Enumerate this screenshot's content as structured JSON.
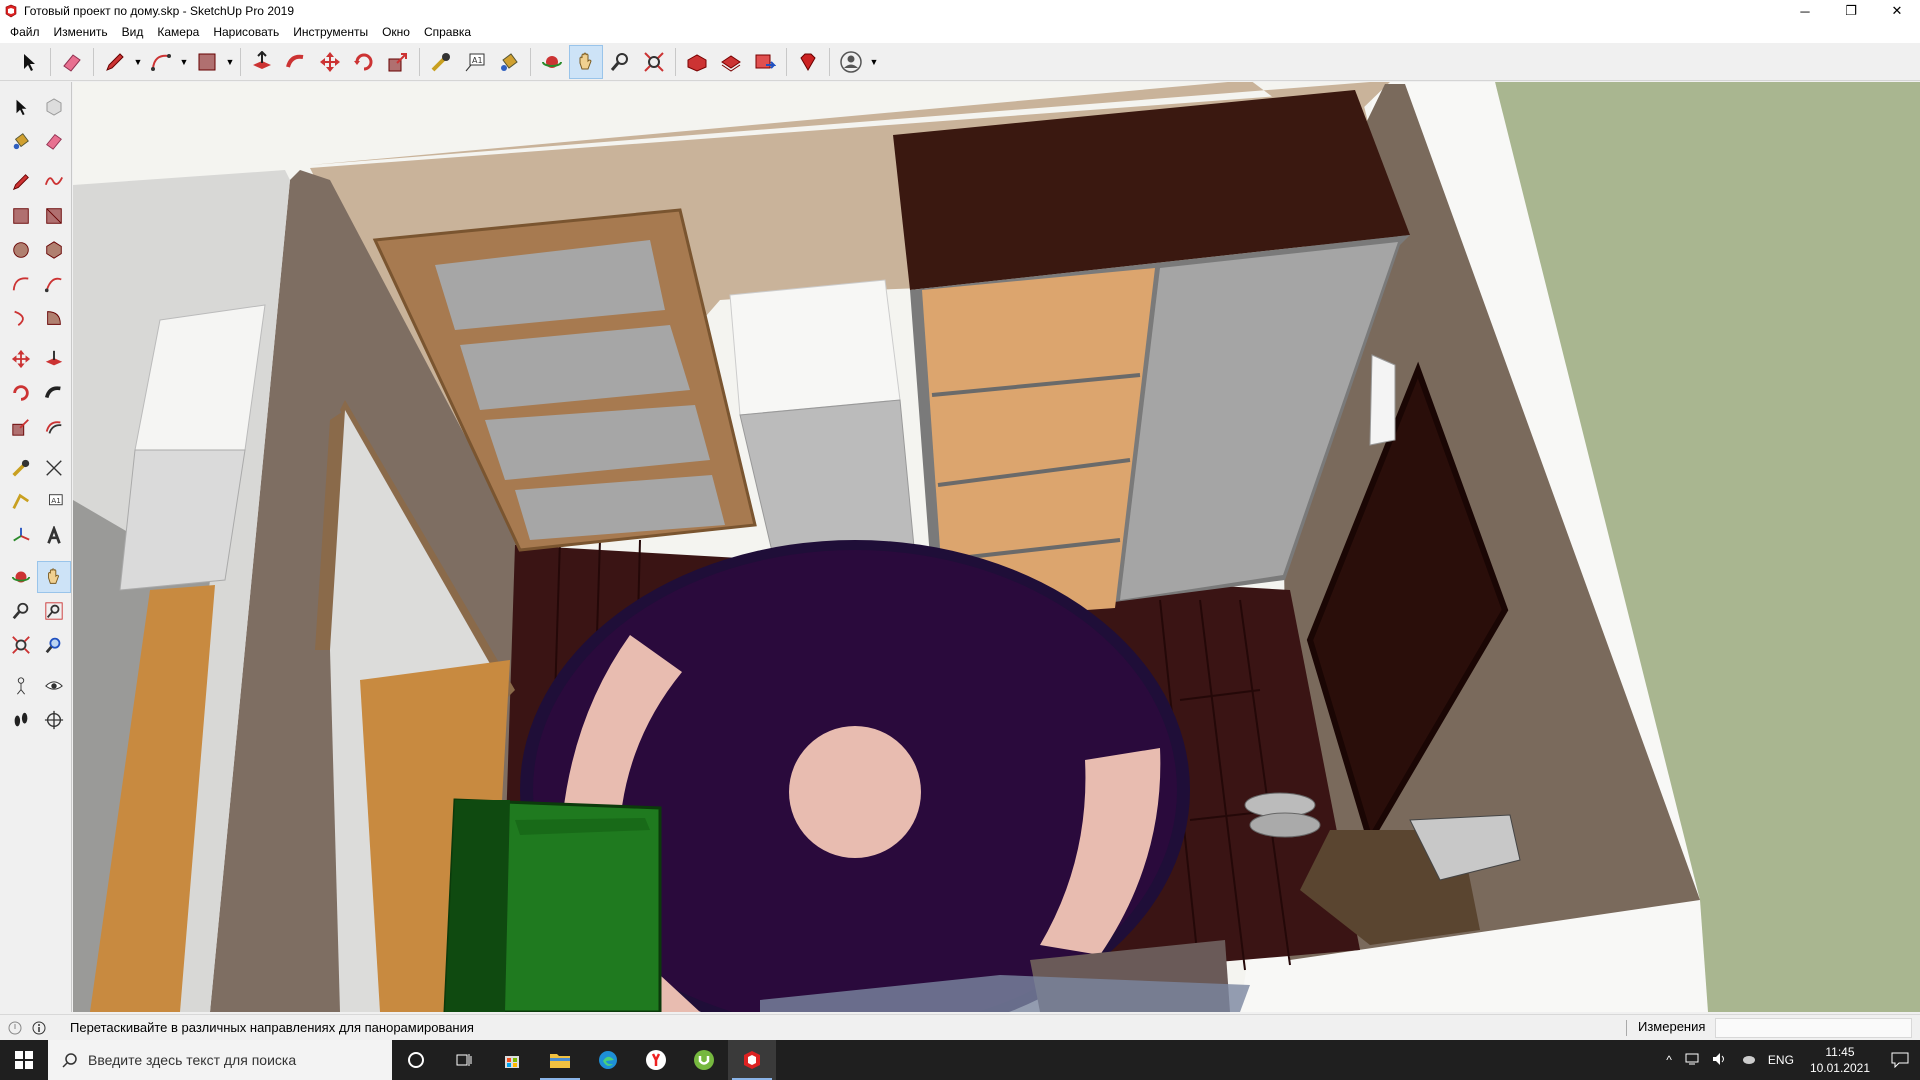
{
  "window": {
    "title": "Готовый проект по дому.skp - SketchUp Pro 2019",
    "minimize": "─",
    "maximize": "❐",
    "close": "✕"
  },
  "menu": {
    "items": [
      "Файл",
      "Изменить",
      "Вид",
      "Камера",
      "Нарисовать",
      "Инструменты",
      "Окно",
      "Справка"
    ]
  },
  "toolbar": {
    "active_tool": "pan-tool"
  },
  "status": {
    "hint": "Перетаскивайте в различных направлениях для панорамирования",
    "measurements_label": "Измерения",
    "measurements_value": ""
  },
  "taskbar": {
    "search_placeholder": "Введите здесь текст для поиска",
    "language": "ENG",
    "time": "11:45",
    "date": "10.01.2021"
  },
  "colors": {
    "floor_wood": "#3a1414",
    "rug": "#2a0a3c",
    "rug_pattern": "#e8bcb0",
    "wardrobe_top": "#3a1810",
    "wardrobe_panel": "#dca56e",
    "wardrobe_door": "#a5a5a5",
    "wall": "#c9b39a",
    "grass": "#a9b690",
    "armchair": "#1f7a1f",
    "accent": "#0078d7"
  }
}
